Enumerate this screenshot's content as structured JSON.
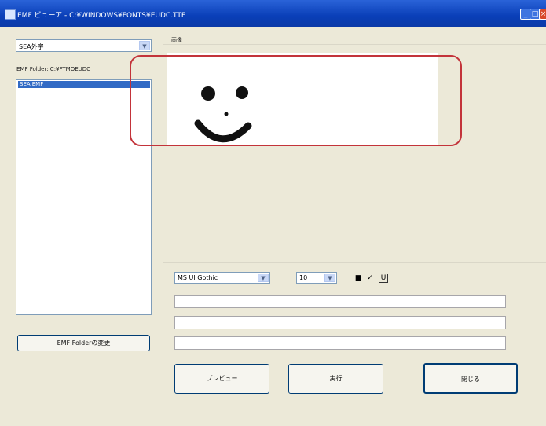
{
  "window": {
    "title": "EMF ビューア - C:¥WINDOWS¥FONTS¥EUDC.TTE",
    "controls": {
      "minimize": "_",
      "maximize": "□",
      "close": "×"
    }
  },
  "left": {
    "combo_value": "SEA外字",
    "folder_label": "EMF Folder: C:¥FTMOEUDC",
    "list_items": [
      "SEA.EMF"
    ],
    "change_folder_button": "EMF Folderの変更"
  },
  "right": {
    "preview_label": "画像",
    "font_combo": "MS UI Gothic",
    "size_combo": "10",
    "tools": {
      "bold": "■",
      "pen": "✓",
      "underline": "U"
    },
    "text_fields": [
      "",
      "",
      ""
    ],
    "buttons": {
      "preview": "プレビュー",
      "run": "実行",
      "close": "閉じる"
    }
  },
  "colors": {
    "accent": "#316ac5",
    "highlight_box": "#c3333a",
    "titlebar": "#0a3fb8"
  }
}
